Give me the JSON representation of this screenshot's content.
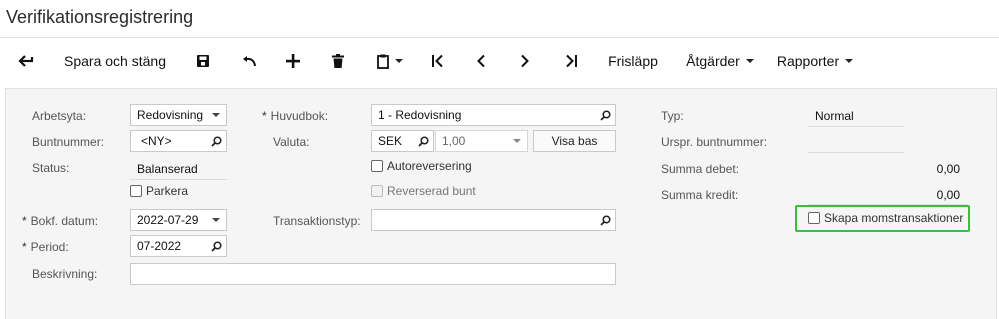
{
  "header": {
    "title": "Verifikationsregistrering"
  },
  "toolbar": {
    "save_close_label": "Spara och stäng",
    "release_label": "Frisläpp",
    "actions_label": "Åtgärder",
    "reports_label": "Rapporter",
    "icons": [
      "back-arrow-icon",
      "save-icon",
      "undo-icon",
      "add-icon",
      "delete-icon",
      "copy-paste-icon",
      "first-record-icon",
      "previous-record-icon",
      "next-record-icon",
      "last-record-icon"
    ]
  },
  "form": {
    "workspace": {
      "label": "Arbetsyta:",
      "value": "Redovisning"
    },
    "batch_number": {
      "label": "Buntnummer:",
      "value": "<NY>"
    },
    "status": {
      "label": "Status:",
      "value": "Balanserad"
    },
    "hold": {
      "label": "Parkera",
      "checked": false
    },
    "transaction_date": {
      "label": "Bokf. datum:",
      "value": "2022-07-29",
      "required_mark": "*"
    },
    "period": {
      "label": "Period:",
      "value": "07-2022",
      "required_mark": "*"
    },
    "description": {
      "label": "Beskrivning:",
      "value": ""
    },
    "ledger": {
      "label": "Huvudbok:",
      "value": "1 - Redovisning",
      "required_mark": "*"
    },
    "currency": {
      "label": "Valuta:",
      "code": "SEK",
      "rate": "1,00",
      "view_base_label": "Visa bas"
    },
    "auto_reversing": {
      "label": "Autoreversering",
      "checked": false
    },
    "reversing_batch": {
      "label": "Reverserad bunt",
      "checked": false,
      "disabled": true
    },
    "transaction_type": {
      "label": "Transaktionstyp:",
      "value": ""
    },
    "type": {
      "label": "Typ:",
      "value": "Normal"
    },
    "orig_batch_number": {
      "label": "Urspr. buntnummer:",
      "value": ""
    },
    "debit_total": {
      "label": "Summa debet:",
      "value": "0,00"
    },
    "credit_total": {
      "label": "Summa kredit:",
      "value": "0,00"
    },
    "create_tax_transactions": {
      "label": "Skapa momstransaktioner",
      "checked": false,
      "highlight_color": "#3ebc3e"
    }
  }
}
